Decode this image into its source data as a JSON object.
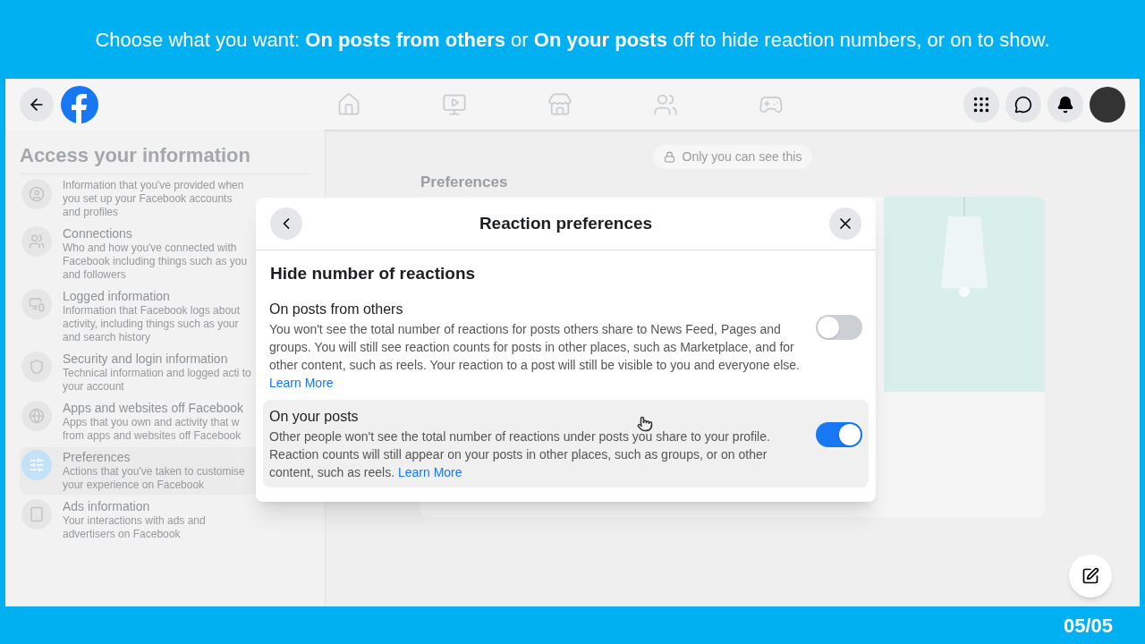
{
  "caption": "Choose what you want: **On posts from others** or **On your posts** off to hide reaction numbers, or on to show.",
  "slide_number": "05/05",
  "sidebar": {
    "title": "Access your information",
    "items": [
      {
        "kind": "profile",
        "description": "Information that you've provided when you set up your Facebook accounts and profiles",
        "selected": false
      },
      {
        "kind": "connections",
        "title": "Connections",
        "description": "Who and how you've connected with Facebook including things such as you and followers",
        "selected": false
      },
      {
        "kind": "devices",
        "title": "Logged information",
        "description": "Information that Facebook logs about activity, including things such as your and search history",
        "selected": false
      },
      {
        "kind": "shield",
        "title": "Security and login information",
        "description": "Technical information and logged acti to your account",
        "selected": false
      },
      {
        "kind": "globe",
        "title": "Apps and websites off Facebook",
        "description": "Apps that you own and activity that w from apps and websites off Facebook",
        "selected": false
      },
      {
        "kind": "sliders",
        "title": "Preferences",
        "description": "Actions that you've taken to customise your experience on Facebook",
        "selected": true
      },
      {
        "kind": "ads",
        "title": "Ads information",
        "description": "Your interactions with ads and advertisers on Facebook",
        "selected": false
      }
    ]
  },
  "main": {
    "privacy_note": "Only you can see this",
    "section_title": "Preferences"
  },
  "dialog": {
    "title": "Reaction preferences",
    "section_title": "Hide number of reactions",
    "options": [
      {
        "title": "On posts from others",
        "description": "You won't see the total number of reactions for posts others share to News Feed, Pages and groups. You will still see reaction counts for posts in other places, such as Marketplace, and for other content, such as reels. Your reaction to a post will still be visible to you and everyone else.",
        "link": "Learn More",
        "on": false,
        "highlighted": false
      },
      {
        "title": "On your posts",
        "description": "Other people won't see the total number of reactions under posts you share to your profile. Reaction counts will still appear on your posts in other places, such as groups, or on other content, such as reels.",
        "link": "Learn More",
        "on": true,
        "highlighted": true
      }
    ]
  }
}
